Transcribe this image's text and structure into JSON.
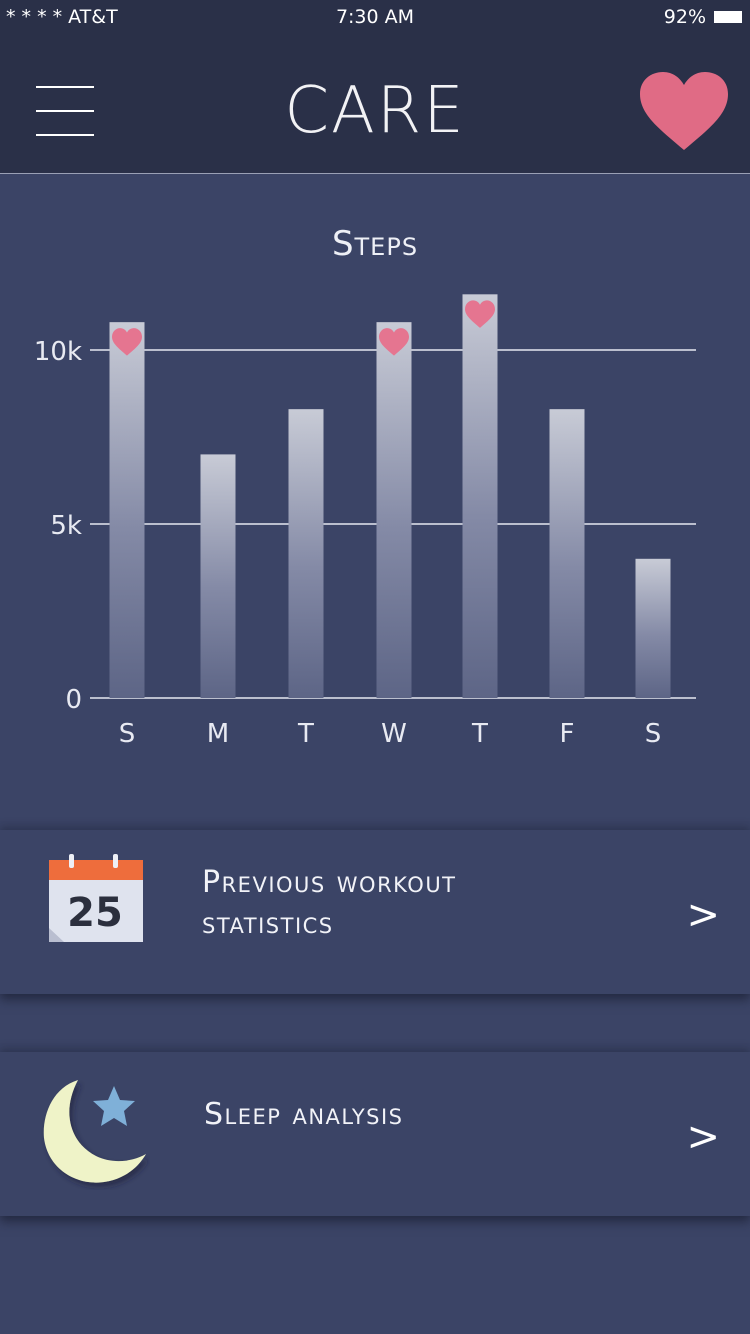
{
  "status_bar": {
    "carrier": "* * * * AT&T",
    "time": "7:30 AM",
    "battery": "92%"
  },
  "header": {
    "title": "CARE",
    "menu_icon": "hamburger-menu-icon",
    "favorite_icon": "heart-icon"
  },
  "chart_data": {
    "type": "bar",
    "title": "Steps",
    "categories": [
      "S",
      "M",
      "T",
      "W",
      "T",
      "F",
      "S"
    ],
    "values": [
      10800,
      7000,
      8300,
      10800,
      11600,
      8300,
      4000
    ],
    "goal_reached": [
      true,
      false,
      false,
      true,
      true,
      false,
      false
    ],
    "y_ticks": [
      {
        "value": 0,
        "label": "0"
      },
      {
        "value": 5000,
        "label": "5k"
      },
      {
        "value": 10000,
        "label": "10k"
      }
    ],
    "ylim": [
      0,
      12000
    ],
    "grid": true,
    "xlabel": "",
    "ylabel": ""
  },
  "cards": [
    {
      "line1": "Previous workout",
      "line2": "statistics",
      "icon": "calendar-icon",
      "calendar_day": "25",
      "chevron": ">"
    },
    {
      "line1": "Sleep analysis",
      "icon": "moon-star-icon",
      "chevron": ">"
    }
  ],
  "colors": {
    "background": "#3b4466",
    "header": "#2a3048",
    "accent_heart": "#e06b85",
    "calendar_top": "#ee6d3c",
    "moon": "#eff3c8",
    "star": "#7fb0d8"
  }
}
